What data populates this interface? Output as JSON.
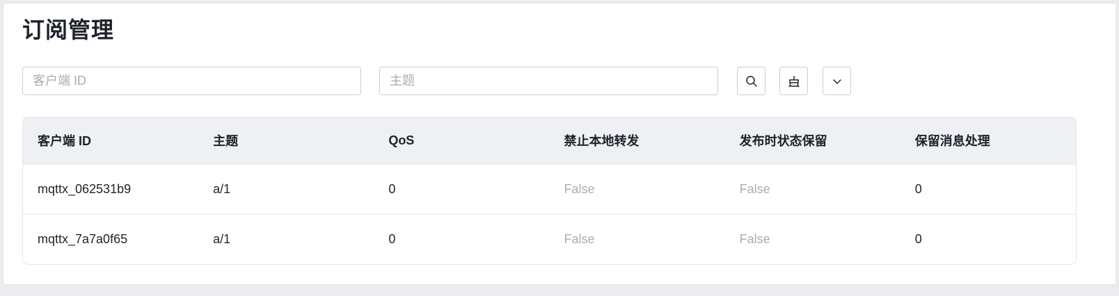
{
  "page": {
    "title": "订阅管理"
  },
  "filters": {
    "client_id_placeholder": "客户端 ID",
    "topic_placeholder": "主题",
    "search_icon": "search-icon",
    "clear_icon": "clear-icon",
    "expand_icon": "chevron-down-icon"
  },
  "table": {
    "headers": [
      "客户端 ID",
      "主题",
      "QoS",
      "禁止本地转发",
      "发布时状态保留",
      "保留消息处理"
    ],
    "rows": [
      [
        "mqttx_062531b9",
        "a/1",
        "0",
        "False",
        "False",
        "0"
      ],
      [
        "mqttx_7a7a0f65",
        "a/1",
        "0",
        "False",
        "False",
        "0"
      ]
    ]
  },
  "colors": {
    "border": "#c9cdd4",
    "header_bg": "#eef0f4",
    "muted_text": "#a8adb7"
  }
}
